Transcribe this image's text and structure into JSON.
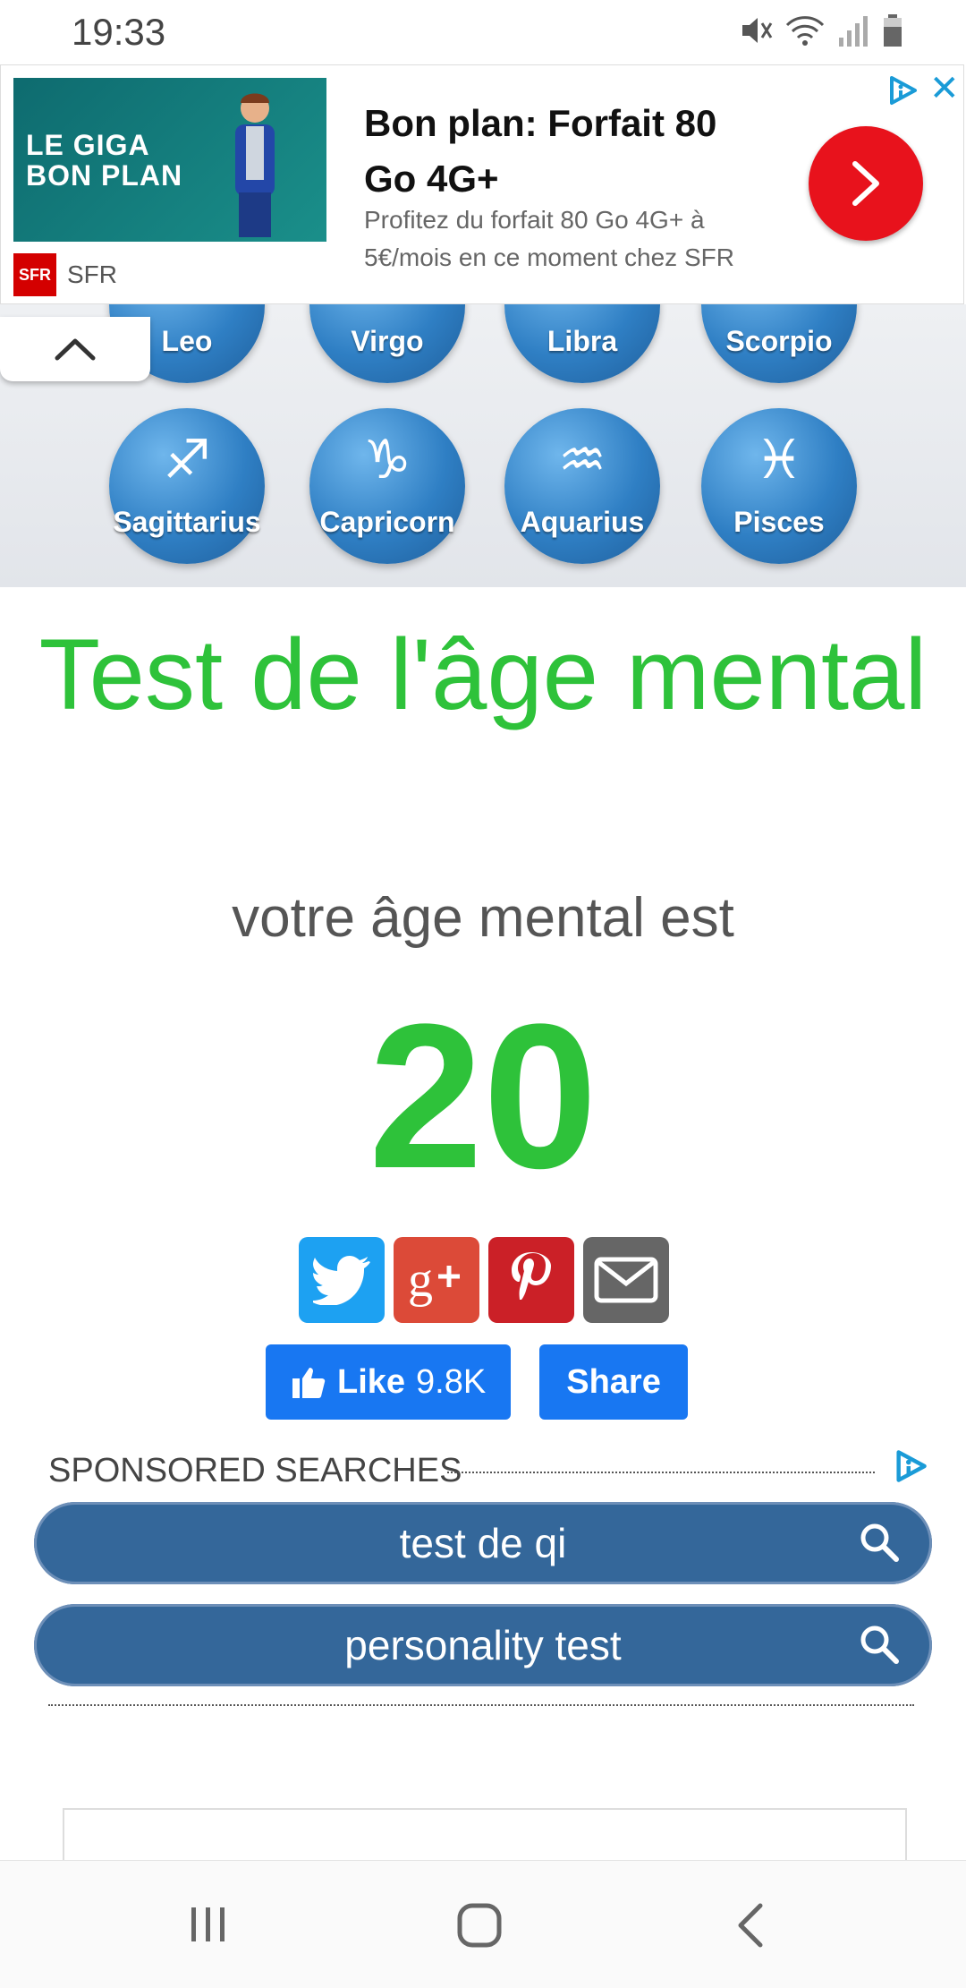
{
  "status_bar": {
    "time": "19:33"
  },
  "ad": {
    "image_text_line1": "LE GIGA",
    "image_text_line2": "BON PLAN",
    "brand_logo_text": "SFR",
    "brand_name": "SFR",
    "title": "Bon plan: Forfait 80 Go 4G+",
    "description": "Profitez du forfait 80 Go 4G+ à 5€/mois en ce moment chez SFR",
    "close_label": "✕"
  },
  "zodiac": {
    "signs_top": [
      "Leo",
      "Virgo",
      "Libra",
      "Scorpio"
    ],
    "signs": [
      {
        "label": "Sagittarius",
        "glyph": "♐"
      },
      {
        "label": "Capricorn",
        "glyph": "♑"
      },
      {
        "label": "Aquarius",
        "glyph": "♒"
      },
      {
        "label": "Pisces",
        "glyph": "♓"
      }
    ]
  },
  "main": {
    "title": "Test de l'âge mental",
    "subtitle": "votre âge mental est",
    "age": "20"
  },
  "share": {
    "buttons": [
      {
        "name": "twitter",
        "color": "#1da1f2"
      },
      {
        "name": "google-plus",
        "color": "#dc4a38"
      },
      {
        "name": "pinterest",
        "color": "#cb2027"
      },
      {
        "name": "email",
        "color": "#666666"
      }
    ],
    "like_label": "Like",
    "like_count": "9.8K",
    "share_label": "Share"
  },
  "sponsored": {
    "heading": "SPONSORED SEARCHES",
    "searches": [
      "test de qi",
      "personality test"
    ]
  },
  "colors": {
    "accent_green": "#2ec23a",
    "facebook_blue": "#1877f2",
    "search_blue": "#34679a"
  }
}
